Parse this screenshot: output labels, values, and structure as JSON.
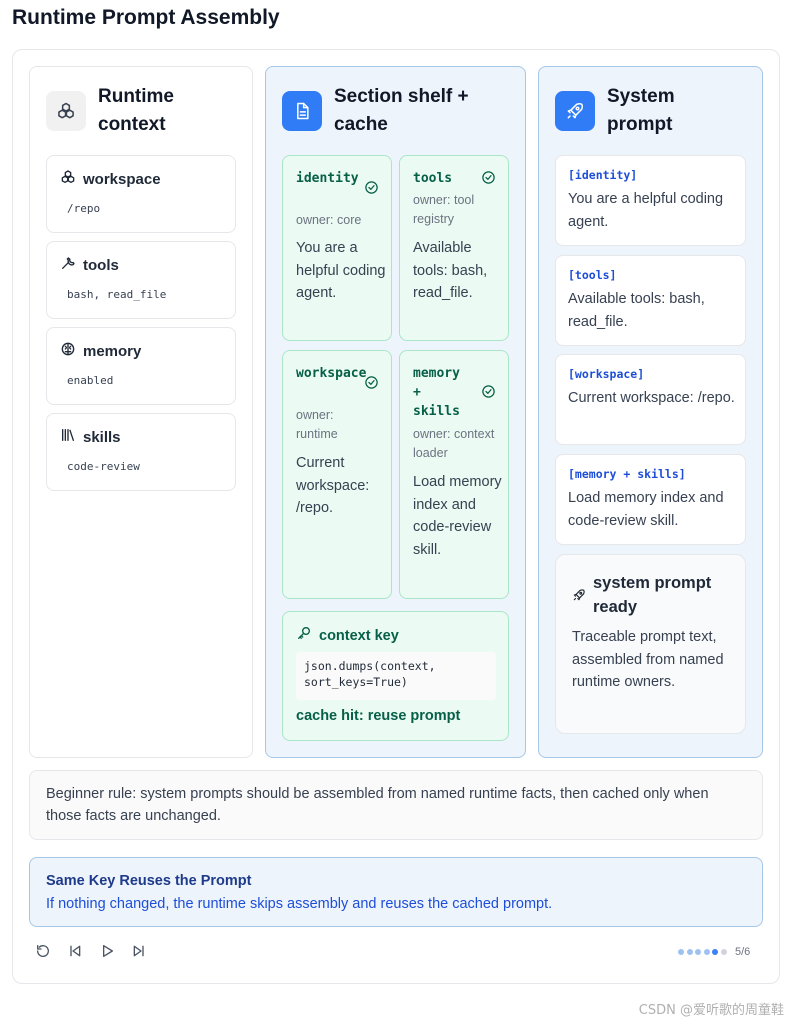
{
  "page": {
    "title": "Runtime Prompt Assembly"
  },
  "context_column": {
    "title": "Runtime context",
    "items": [
      {
        "label": "workspace",
        "value": "/repo",
        "icon": "cubes-icon"
      },
      {
        "label": "tools",
        "value": "bash, read_file",
        "icon": "wrench-icon"
      },
      {
        "label": "memory",
        "value": "enabled",
        "icon": "brain-icon"
      },
      {
        "label": "skills",
        "value": "code-review",
        "icon": "library-icon"
      }
    ]
  },
  "shelf_column": {
    "title": "Section shelf + cache",
    "sections": [
      {
        "name": "identity",
        "owner": "owner: core",
        "body": "You are a helpful coding agent."
      },
      {
        "name": "tools",
        "owner": "owner: tool registry",
        "body": "Available tools: bash, read_file."
      },
      {
        "name": "workspace",
        "owner": "owner: runtime",
        "body": "Current workspace: /repo."
      },
      {
        "name": "memory + skills",
        "owner": "owner: context loader",
        "body": "Load memory index and code-review skill."
      }
    ],
    "context_key": {
      "label": "context key",
      "code": "json.dumps(context, sort_keys=True)",
      "status": "cache hit: reuse prompt"
    }
  },
  "system_column": {
    "title": "System prompt",
    "blocks": [
      {
        "tag": "[identity]",
        "text": "You are a helpful coding agent."
      },
      {
        "tag": "[tools]",
        "text": "Available tools: bash, read_file."
      },
      {
        "tag": "[workspace]",
        "text": "Current workspace: /repo."
      },
      {
        "tag": "[memory + skills]",
        "text": "Load memory index and code-review skill."
      }
    ],
    "ready": {
      "title": "system prompt ready",
      "text": "Traceable prompt text, assembled from named runtime owners."
    }
  },
  "rule": "Beginner rule: system prompts should be assembled from named runtime facts, then cached only when those facts are unchanged.",
  "step": {
    "title": "Same Key Reuses the Prompt",
    "description": "If nothing changed, the runtime skips assembly and reuses the cached prompt."
  },
  "progress": {
    "current": 5,
    "total": 6,
    "label": "5/6"
  },
  "watermark": "CSDN @爱听歌的周童鞋",
  "colors": {
    "accent": "#2f7cf6",
    "success": "#065f46",
    "card_green": "#ebfbf3",
    "panel_blue": "#eef4fc"
  }
}
